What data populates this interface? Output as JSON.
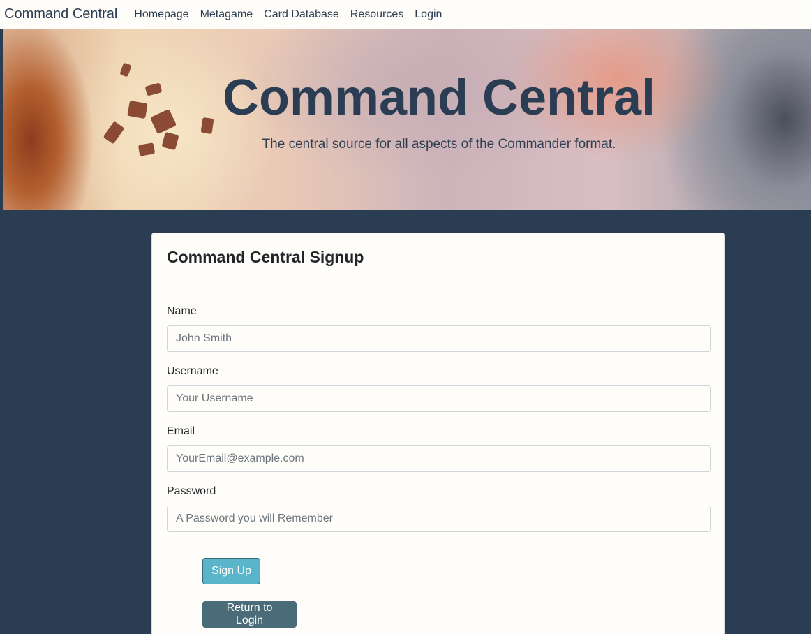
{
  "navbar": {
    "brand": "Command Central",
    "links": [
      "Homepage",
      "Metagame",
      "Card Database",
      "Resources",
      "Login"
    ]
  },
  "hero": {
    "title": "Command Central",
    "subtitle": "The central source for all aspects of the Commander format."
  },
  "signup": {
    "title": "Command Central Signup",
    "name": {
      "label": "Name",
      "placeholder": "John Smith"
    },
    "username": {
      "label": "Username",
      "placeholder": "Your Username"
    },
    "email": {
      "label": "Email",
      "placeholder": "YourEmail@example.com"
    },
    "password": {
      "label": "Password",
      "placeholder": "A Password you will Remember"
    },
    "signup_button": "Sign Up",
    "return_button": "Return to Login"
  },
  "colors": {
    "page_background": "#2b3d53",
    "navbar_background": "#fffdf9",
    "signup_button": "#5bb5ca",
    "return_button": "#4a6b78"
  }
}
